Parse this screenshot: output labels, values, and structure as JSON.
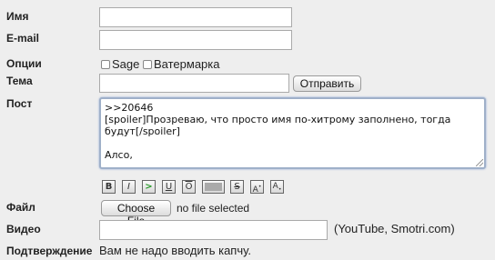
{
  "labels": {
    "name": "Имя",
    "email": "E-mail",
    "options": "Опции",
    "subject": "Тема",
    "post": "Пост",
    "file": "Файл",
    "video": "Видео",
    "confirm": "Подтверждение"
  },
  "options": {
    "sage": "Sage",
    "watermark": "Ватермарка"
  },
  "submit_label": "Отправить",
  "post_text": ">>20646\n[spoiler]Прозреваю, что просто имя по-хитрому заполнено, тогда будут[/spoiler]\n\nАлсо,",
  "toolbar": {
    "bold": "B",
    "italic": "I",
    "quote": ">",
    "underline": "U",
    "overline": "O",
    "spoiler": "",
    "strike": "S",
    "sup": "A",
    "sub": "A"
  },
  "file": {
    "choose_label": "Choose File",
    "status": "no file selected"
  },
  "video_hint": "(YouTube, Smotri.com)",
  "captcha_note": "Вам не надо вводить капчу."
}
